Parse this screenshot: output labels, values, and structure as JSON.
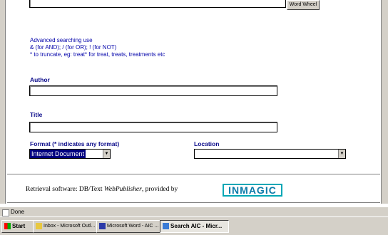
{
  "form": {
    "word_wheel_button": "Word Wheel",
    "help_lines": [
      "Advanced searching use",
      "& (for AND); / (for OR); ! (for NOT)",
      "* to truncate, eg: treat* for treat, treats, treatments etc"
    ],
    "author_label": "Author",
    "title_label": "Title",
    "format_label": "Format (* indicates any format)",
    "format_value": "Internet Document",
    "location_label": "Location",
    "location_value": ""
  },
  "footer": {
    "prefix": "Retrieval software: DB/Text ",
    "product": "WebPublisher",
    "suffix": ", provided by",
    "logo": "INMAGIC"
  },
  "status": {
    "text": "Done"
  },
  "taskbar": {
    "start": "Start",
    "tasks": [
      "Inbox - Microsoft Outl...",
      "Microsoft Word - AIC ...",
      "Search AIC - Micr..."
    ]
  }
}
